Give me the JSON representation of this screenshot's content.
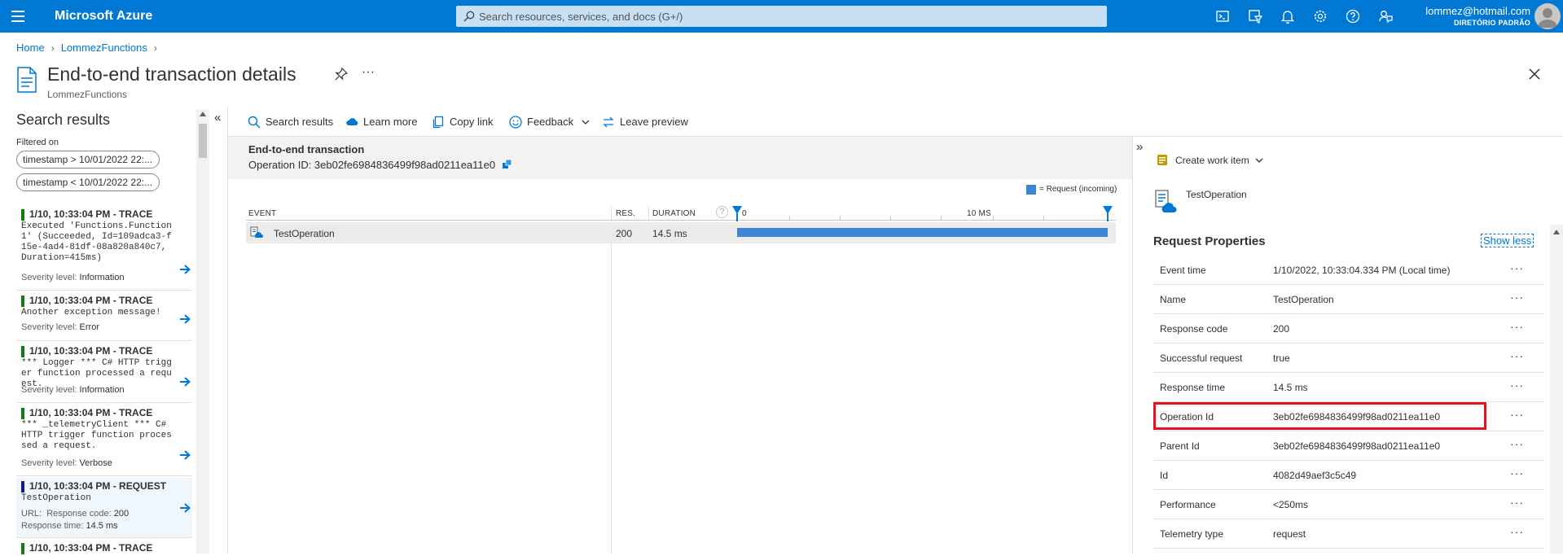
{
  "topbar": {
    "brand": "Microsoft Azure",
    "search_placeholder": "Search resources, services, and docs (G+/)",
    "user": "lommez@hotmail.com",
    "directory": "DIRETÓRIO PADRÃO",
    "icons": [
      "cloud-shell-icon",
      "directory-filter-icon",
      "notifications-icon",
      "settings-icon",
      "help-icon",
      "feedback-icon"
    ],
    "color": "#0078d4"
  },
  "breadcrumb": [
    "Home",
    "LommezFunctions"
  ],
  "header": {
    "title": "End-to-end transaction details",
    "subtitle": "LommezFunctions"
  },
  "search_results": {
    "title": "Search results",
    "filtered_on": "Filtered on",
    "filters": [
      "timestamp > 10/01/2022 22:...",
      "timestamp < 10/01/2022 22:..."
    ],
    "items": [
      {
        "header": "1/10, 10:33:04 PM - TRACE",
        "body": "Executed 'Functions.Function1' (Succeeded, Id=109adca3-f15e-4ad4-81df-08a820a840c7, Duration=415ms)",
        "line_label": "Severity level:",
        "line_value": "Information"
      },
      {
        "header": "1/10, 10:33:04 PM - TRACE",
        "body": "Another exception message!",
        "line_label": "Severity level:",
        "line_value": "Error"
      },
      {
        "header": "1/10, 10:33:04 PM - TRACE",
        "body": "*** Logger *** C# HTTP trigger function processed a request.",
        "line_label": "Severity level:",
        "line_value": "Information"
      },
      {
        "header": "1/10, 10:33:04 PM - TRACE",
        "body": "*** _telemetryClient *** C# HTTP trigger function processed a request.",
        "line_label": "Severity level:",
        "line_value": "Verbose"
      },
      {
        "header": "1/10, 10:33:04 PM - REQUEST",
        "body": "TestOperation",
        "url_label": "URL:",
        "line_label": "Response code:",
        "line_value": "200",
        "extra_label": "Response time:",
        "extra_value": "14.5 ms"
      },
      {
        "header": "1/10, 10:33:04 PM - TRACE"
      }
    ]
  },
  "toolbar": {
    "search_results": "Search results",
    "learn_more": "Learn more",
    "copy_link": "Copy link",
    "feedback": "Feedback",
    "leave_preview": "Leave preview"
  },
  "transaction": {
    "title": "End-to-end transaction",
    "operation_id": "Operation ID: 3eb02fe6984836499f98ad0211ea11e0",
    "legend": "= Request (incoming)",
    "columns": {
      "event": "EVENT",
      "res": "RES.",
      "duration": "DURATION"
    },
    "timeline_ticks": [
      "0",
      "10 MS"
    ],
    "row": {
      "event": "TestOperation",
      "res": "200",
      "duration": "14.5 ms"
    }
  },
  "details": {
    "create_work_item": "Create work item",
    "operation": "TestOperation",
    "section_title": "Request Properties",
    "show_less": "Show less",
    "properties": [
      {
        "key": "Event time",
        "value": "1/10/2022, 10:33:04.334 PM (Local time)"
      },
      {
        "key": "Name",
        "value": "TestOperation"
      },
      {
        "key": "Response code",
        "value": "200"
      },
      {
        "key": "Successful request",
        "value": "true"
      },
      {
        "key": "Response time",
        "value": "14.5 ms"
      },
      {
        "key": "Operation Id",
        "value": "3eb02fe6984836499f98ad0211ea11e0"
      },
      {
        "key": "Parent Id",
        "value": "3eb02fe6984836499f98ad0211ea11e0"
      },
      {
        "key": "Id",
        "value": "4082d49aef3c5c49"
      },
      {
        "key": "Performance",
        "value": "<250ms"
      },
      {
        "key": "Telemetry type",
        "value": "request"
      }
    ],
    "more_label": "···"
  }
}
